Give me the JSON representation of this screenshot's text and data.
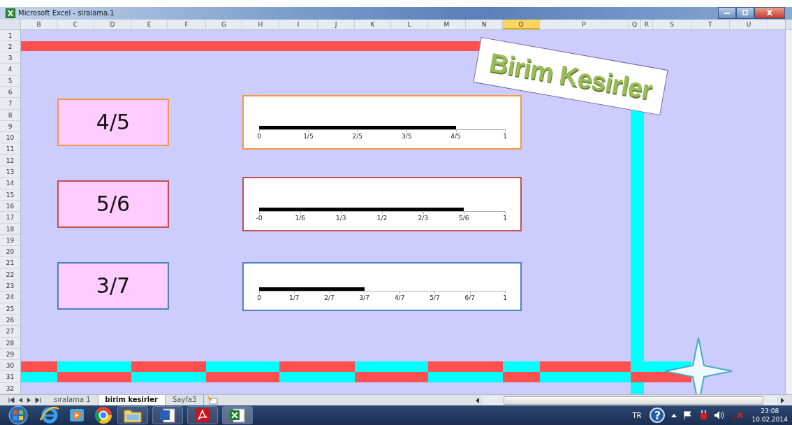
{
  "window": {
    "title": "Microsoft Excel - siralama.1"
  },
  "columns": [
    {
      "label": "B",
      "selected": false
    },
    {
      "label": "C",
      "selected": false
    },
    {
      "label": "D",
      "selected": false
    },
    {
      "label": "E",
      "selected": false
    },
    {
      "label": "F",
      "selected": false
    },
    {
      "label": "G",
      "selected": false
    },
    {
      "label": "H",
      "selected": false
    },
    {
      "label": "I",
      "selected": false
    },
    {
      "label": "J",
      "selected": false
    },
    {
      "label": "K",
      "selected": false
    },
    {
      "label": "L",
      "selected": false
    },
    {
      "label": "M",
      "selected": false
    },
    {
      "label": "N",
      "selected": false
    },
    {
      "label": "O",
      "selected": true
    },
    {
      "label": "P",
      "selected": false
    },
    {
      "label": "Q",
      "selected": false
    },
    {
      "label": "R",
      "selected": false
    },
    {
      "label": "S",
      "selected": false
    },
    {
      "label": "T",
      "selected": false
    },
    {
      "label": "U",
      "selected": false
    }
  ],
  "rows": [
    "1",
    "2",
    "3",
    "4",
    "5",
    "6",
    "7",
    "8",
    "9",
    "10",
    "11",
    "12",
    "13",
    "14",
    "15",
    "16",
    "17",
    "18",
    "19",
    "20",
    "21",
    "22",
    "23",
    "24",
    "25",
    "26",
    "27",
    "28",
    "29",
    "30",
    "31",
    "32"
  ],
  "banner": {
    "title": "Birim Kesirler"
  },
  "fractions": [
    {
      "label": "4/5",
      "color": "#f79646",
      "level": 0.8,
      "ticks": [
        "0",
        "1/5",
        "2/5",
        "3/5",
        "4/5",
        "1"
      ]
    },
    {
      "label": "5/6",
      "color": "#c0504d",
      "level": 0.8333,
      "ticks": [
        "-0",
        "1/6",
        "1/3",
        "1/2",
        "2/3",
        "5/6",
        "1"
      ]
    },
    {
      "label": "3/7",
      "color": "#4f81bd",
      "level": 0.4286,
      "ticks": [
        "0",
        "1/7",
        "2/7",
        "3/7",
        "4/7",
        "5/7",
        "6/7",
        "1"
      ]
    }
  ],
  "sheet_tabs": [
    {
      "label": "sıralama 1",
      "selected": false
    },
    {
      "label": "birim kesirler",
      "selected": true
    },
    {
      "label": "Sayfa3",
      "selected": false
    }
  ],
  "tray": {
    "language": "TR",
    "help": "?",
    "time": "23:08",
    "date": "10.02.2014"
  }
}
